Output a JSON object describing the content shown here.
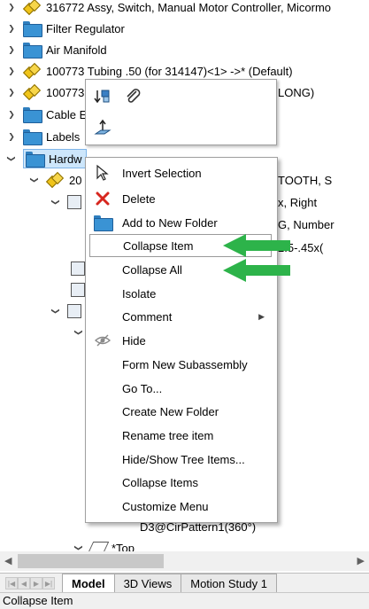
{
  "tree": {
    "items": [
      {
        "label": "316772 Assy, Switch, Manual Motor Controller, Micormo"
      },
      {
        "label": "Filter Regulator"
      },
      {
        "label": "Air Manifold"
      },
      {
        "label": "100773 Tubing .50 (for 314147)<1> ->* (Default)"
      },
      {
        "label": "100773",
        "label_right": "LONG)"
      },
      {
        "label": "Cable E"
      },
      {
        "label": "Labels"
      },
      {
        "label": "Hardw"
      },
      {
        "label": "20",
        "label_right": "TOOTH, S"
      },
      {
        "label_right": "x, Right"
      },
      {
        "label_right": "G, Number"
      },
      {
        "label_right": "2.5-.45x("
      },
      {
        "label": "D3@CirPattern1(360°)"
      },
      {
        "label": "*Top"
      }
    ]
  },
  "mini_toolbar": {
    "buttons": [
      {
        "icon": "reorder-icon"
      },
      {
        "icon": "paperclip-icon"
      },
      {
        "icon": "plane-normal-icon"
      }
    ]
  },
  "context_menu": {
    "items": [
      {
        "label": "Invert Selection",
        "icon": "cursor-icon"
      },
      {
        "label": "Delete",
        "icon": "delete-x-icon"
      },
      {
        "label": "Add to New Folder",
        "icon": "folder-icon"
      },
      {
        "label": "Collapse Item"
      },
      {
        "label": "Collapse All"
      },
      {
        "label": "Isolate"
      },
      {
        "label": "Comment",
        "has_submenu": true
      },
      {
        "label": "Hide",
        "icon": "eye-hidden-icon"
      },
      {
        "label": "Form New Subassembly"
      },
      {
        "label": "Go To..."
      },
      {
        "label": "Create New Folder"
      },
      {
        "label": "Rename tree item"
      },
      {
        "label": "Hide/Show Tree Items..."
      },
      {
        "label": "Collapse Items"
      },
      {
        "label": "Customize Menu"
      }
    ]
  },
  "tabs": [
    {
      "label": "Model",
      "active": true
    },
    {
      "label": "3D Views"
    },
    {
      "label": "Motion Study 1"
    }
  ],
  "status_bar": {
    "text": "Collapse Item"
  },
  "colors": {
    "annotation_arrow": "#2db34a",
    "folder": "#3a93d4",
    "selection": "#cde6fb"
  }
}
